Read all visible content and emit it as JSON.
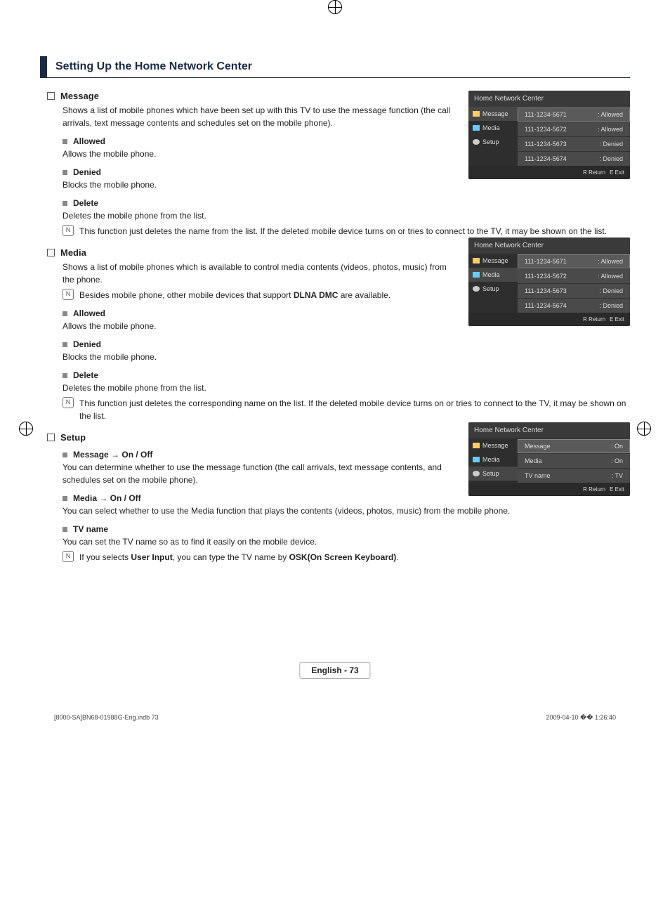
{
  "section_title": "Setting Up the Home Network Center",
  "message": {
    "heading": "Message",
    "desc": "Shows a list of mobile phones which have been set up with this TV to use the message function (the call arrivals, text message contents and schedules set on the mobile phone).",
    "allowed_h": "Allowed",
    "allowed_d": "Allows the mobile phone.",
    "denied_h": "Denied",
    "denied_d": "Blocks the mobile phone.",
    "delete_h": "Delete",
    "delete_d": "Deletes the mobile phone from the list.",
    "delete_note": "This function just deletes the name from the list. If the deleted mobile device turns on or tries to connect to the TV, it may be shown on the list."
  },
  "media": {
    "heading": "Media",
    "desc": "Shows a list of mobile phones which is available to control media contents (videos, photos, music) from the phone.",
    "note1_a": "Besides mobile phone, other mobile devices that support ",
    "note1_b": "DLNA DMC",
    "note1_c": " are available.",
    "allowed_h": "Allowed",
    "allowed_d": "Allows the mobile phone.",
    "denied_h": "Denied",
    "denied_d": "Blocks the mobile phone.",
    "delete_h": "Delete",
    "delete_d": "Deletes the mobile phone from the list.",
    "delete_note": "This function just deletes the corresponding name on the list. If the deleted mobile device turns on or tries to connect to the TV, it may be shown on the list."
  },
  "setup": {
    "heading": "Setup",
    "msg_h": "Message → On / Off",
    "msg_d": "You can determine whether to use the message function (the call arrivals, text message contents, and schedules set on the mobile phone).",
    "med_h": "Media → On / Off",
    "med_d": "You can select whether to use the Media function that plays the contents (videos, photos, music) from the mobile phone.",
    "tv_h": "TV name",
    "tv_d": "You can set the TV name so as to find it easily on the mobile device.",
    "tv_note_a": "If you selects ",
    "tv_note_b": "User Input",
    "tv_note_c": ", you can type the TV name by ",
    "tv_note_d": "OSK(On Screen Keyboard)",
    "tv_note_e": "."
  },
  "panel": {
    "title": "Home Network Center",
    "nav_message": "Message",
    "nav_media": "Media",
    "nav_setup": "Setup",
    "return": "R Return",
    "exit": "E Exit",
    "rows_msg": [
      {
        "num": "111-1234-5671",
        "st": ": Allowed"
      },
      {
        "num": "111-1234-5672",
        "st": ": Allowed"
      },
      {
        "num": "111-1234-5673",
        "st": ": Denied"
      },
      {
        "num": "111-1234-5674",
        "st": ": Denied"
      }
    ],
    "rows_setup": [
      {
        "k": "Message",
        "v": ": On"
      },
      {
        "k": "Media",
        "v": ": On"
      },
      {
        "k": "TV name",
        "v": ": TV"
      }
    ]
  },
  "footer": "English - 73",
  "meta_left": "[8000-SA]BN68-01988G-Eng.indb   73",
  "meta_right": "2009-04-10   �� 1:26:40"
}
